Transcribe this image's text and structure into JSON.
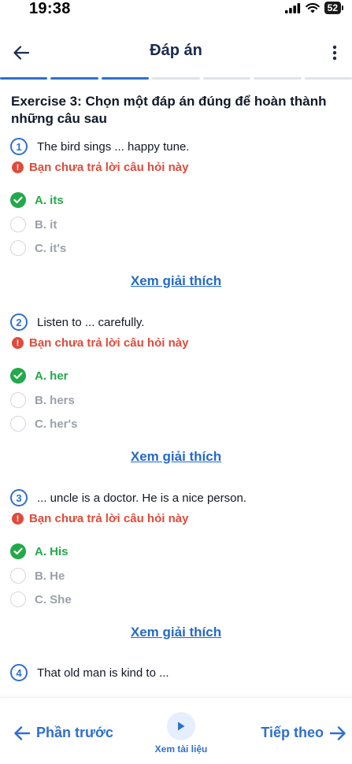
{
  "status_bar": {
    "time": "19:38",
    "battery": "52"
  },
  "header": {
    "title": "Đáp án"
  },
  "progress": {
    "total_segments": 7,
    "completed_segments": 3
  },
  "exercise": {
    "title": "Exercise 3: Chọn một đáp án đúng để hoàn thành những câu sau"
  },
  "questions": [
    {
      "number": "1",
      "text": "The bird sings ... happy tune.",
      "warning": "Bạn chưa trả lời câu hỏi này",
      "options": [
        {
          "label": "A. its",
          "correct": true
        },
        {
          "label": "B. it",
          "correct": false
        },
        {
          "label": "C. it's",
          "correct": false
        }
      ],
      "explain_label": "Xem giải thích"
    },
    {
      "number": "2",
      "text": "Listen to ... carefully.",
      "warning": "Bạn chưa trả lời câu hỏi này",
      "options": [
        {
          "label": "A. her",
          "correct": true
        },
        {
          "label": "B. hers",
          "correct": false
        },
        {
          "label": "C. her's",
          "correct": false
        }
      ],
      "explain_label": "Xem giải thích"
    },
    {
      "number": "3",
      "text": "... uncle is a doctor. He is a nice person.",
      "warning": "Bạn chưa trả lời câu hỏi này",
      "options": [
        {
          "label": "A. His",
          "correct": true
        },
        {
          "label": "B. He",
          "correct": false
        },
        {
          "label": "C. She",
          "correct": false
        }
      ],
      "explain_label": "Xem giải thích"
    },
    {
      "number": "4",
      "text": "That old man is kind to ..."
    }
  ],
  "bottom_bar": {
    "prev_label": "Phần trước",
    "doc_label": "Xem tài liệu",
    "next_label": "Tiếp theo"
  },
  "colors": {
    "accent": "#2f6fd1",
    "correct": "#22a94a",
    "warning": "#e04a3a",
    "link": "#2469c9"
  }
}
